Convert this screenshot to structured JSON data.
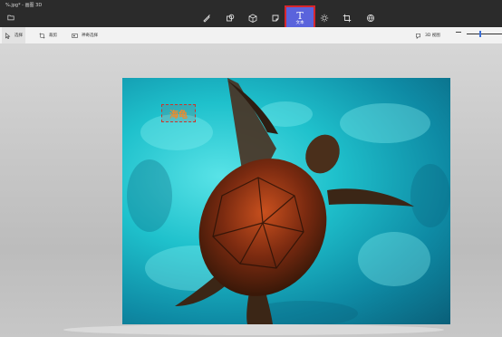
{
  "window": {
    "title": "%.jpg* - 画图 3D"
  },
  "ribbon": {
    "tools": [
      {
        "name": "brushes",
        "icon": "brush-icon"
      },
      {
        "name": "2d-shapes",
        "icon": "shapes-2d-icon"
      },
      {
        "name": "3d-shapes",
        "icon": "cube-icon"
      },
      {
        "name": "stickers",
        "icon": "sticker-icon"
      },
      {
        "name": "text",
        "icon": "text-icon",
        "glyph": "T",
        "label": "文本",
        "active": true
      },
      {
        "name": "effects",
        "icon": "effects-icon"
      },
      {
        "name": "canvas",
        "icon": "canvas-crop-icon"
      },
      {
        "name": "3d-library",
        "icon": "library-icon"
      }
    ],
    "active_color": "#5a63dc",
    "highlight_color": "#d7262d"
  },
  "toolbar": {
    "select_label": "选择",
    "crop_label": "裁剪",
    "magic_select_label": "神奇选择",
    "view3d_label": "3D 视图",
    "zoom_minus": "—"
  },
  "canvas": {
    "text_box_value": "海龟",
    "text_color": "#f08a2a",
    "water_color": "#1fc1cc"
  }
}
